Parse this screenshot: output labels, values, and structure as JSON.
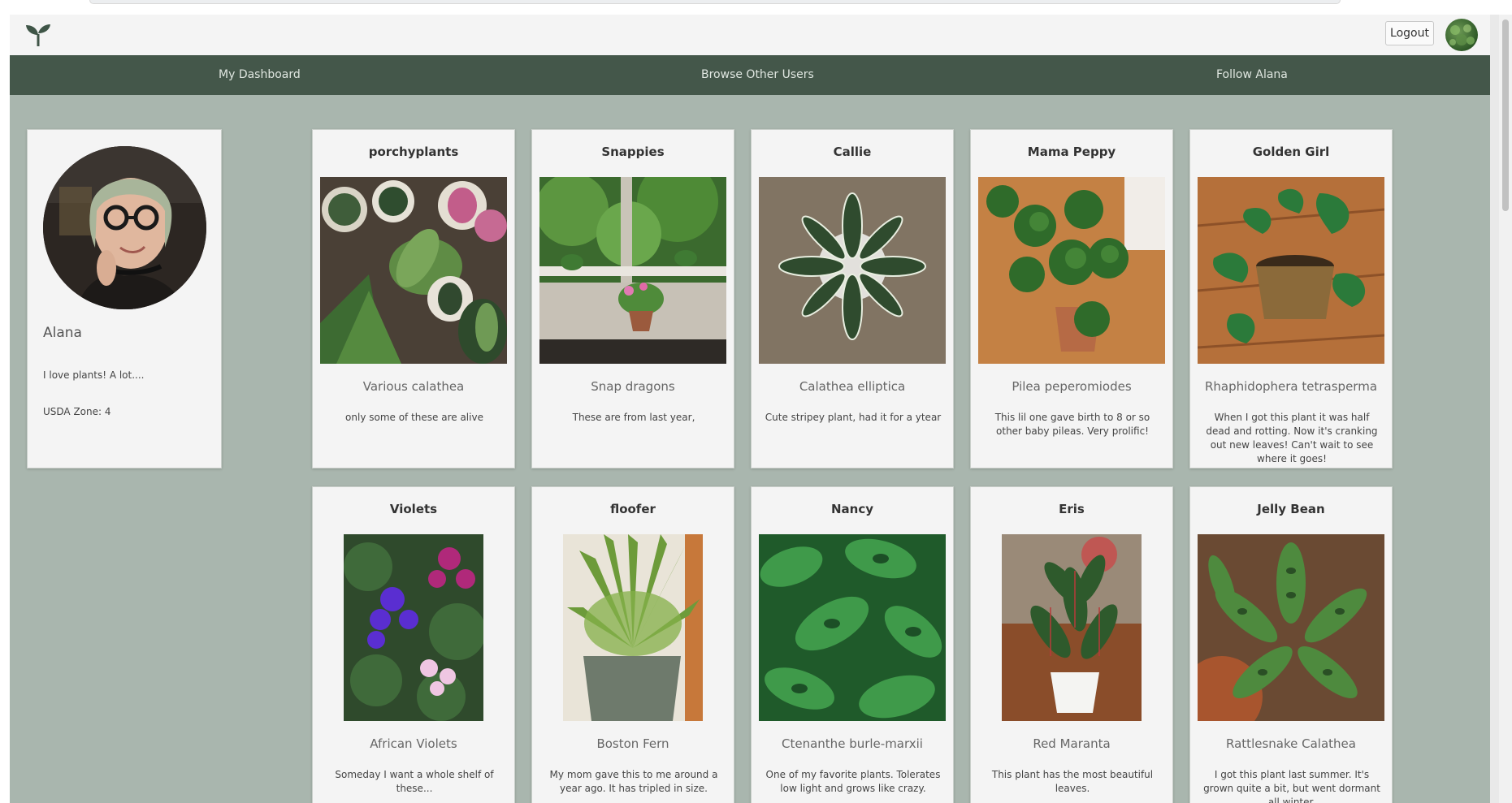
{
  "topbar": {
    "logo": "sprout-icon",
    "logout_label": "Logout",
    "avatar": "user-avatar"
  },
  "nav": {
    "items": [
      "My Dashboard",
      "Browse Other Users",
      "Follow Alana"
    ]
  },
  "profile": {
    "name": "Alana",
    "bio": "I love plants! A lot....",
    "zone": "USDA Zone: 4"
  },
  "plants": [
    {
      "nickname": "porchyplants",
      "species": "Various calathea",
      "description": "only some of these are alive"
    },
    {
      "nickname": "Snappies",
      "species": "Snap dragons",
      "description": "These are from last year,"
    },
    {
      "nickname": "Callie",
      "species": "Calathea elliptica",
      "description": "Cute stripey plant, had it for a ytear"
    },
    {
      "nickname": "Mama Peppy",
      "species": "Pilea peperomiodes",
      "description": "This lil one gave birth to 8 or so other baby pileas. Very prolific!"
    },
    {
      "nickname": "Golden Girl",
      "species": "Rhaphidophera tetrasperma",
      "description": "When I got this plant it was half dead and rotting. Now it's cranking out new leaves! Can't wait to see where it goes!"
    },
    {
      "nickname": "Violets",
      "species": "African Violets",
      "description": "Someday I want a whole shelf of these..."
    },
    {
      "nickname": "floofer",
      "species": "Boston Fern",
      "description": "My mom gave this to me around a year ago. It has tripled in size."
    },
    {
      "nickname": "Nancy",
      "species": "Ctenanthe burle-marxii",
      "description": "One of my favorite plants. Tolerates low light and grows like crazy."
    },
    {
      "nickname": "Eris",
      "species": "Red Maranta",
      "description": "This plant has the most beautiful leaves."
    },
    {
      "nickname": "Jelly Bean",
      "species": "Rattlesnake Calathea",
      "description": "I got this plant last summer. It's grown quite a bit, but went dormant all winter."
    }
  ],
  "colors": {
    "nav_bg": "#44574a",
    "page_bg": "#a9b6ae",
    "card_bg": "#f4f4f4"
  }
}
